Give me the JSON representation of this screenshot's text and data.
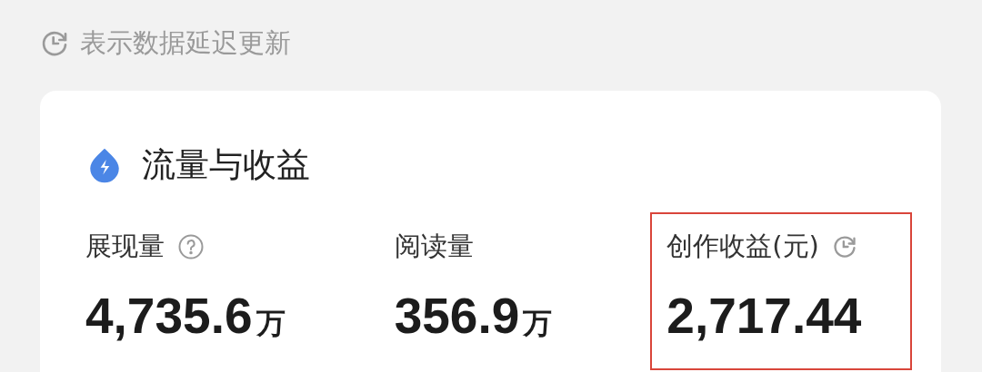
{
  "notice": {
    "text": "表示数据延迟更新"
  },
  "card": {
    "title": "流量与收益",
    "metrics": [
      {
        "label": "展现量",
        "help_icon": true,
        "value": "4,735.6",
        "unit": "万",
        "highlighted": false
      },
      {
        "label": "阅读量",
        "value": "356.9",
        "unit": "万",
        "highlighted": false
      },
      {
        "label": "创作收益(元)",
        "delay_icon": true,
        "value": "2,717.44",
        "highlighted": true
      }
    ]
  }
}
